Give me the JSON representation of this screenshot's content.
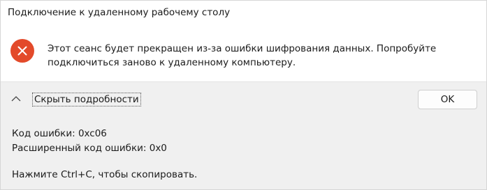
{
  "window": {
    "title": "Подключение к удаленному рабочему столу"
  },
  "message": {
    "icon": "error-icon",
    "text": "Этот сеанс будет прекращен из-за ошибки шифрования данных. Попробуйте подключиться заново к удаленному компьютеру."
  },
  "footer": {
    "toggle_icon": "chevron-up-icon",
    "toggle_label": "Скрыть подробности",
    "ok_label": "OK"
  },
  "details": {
    "error_code": "Код ошибки: 0xc06",
    "extended_error_code": "Расширенный код ошибки: 0x0",
    "copy_hint": "Нажмите Ctrl+C, чтобы скопировать."
  },
  "colors": {
    "error_icon": "#e34a2a",
    "panel_background": "#f0f0f0"
  }
}
